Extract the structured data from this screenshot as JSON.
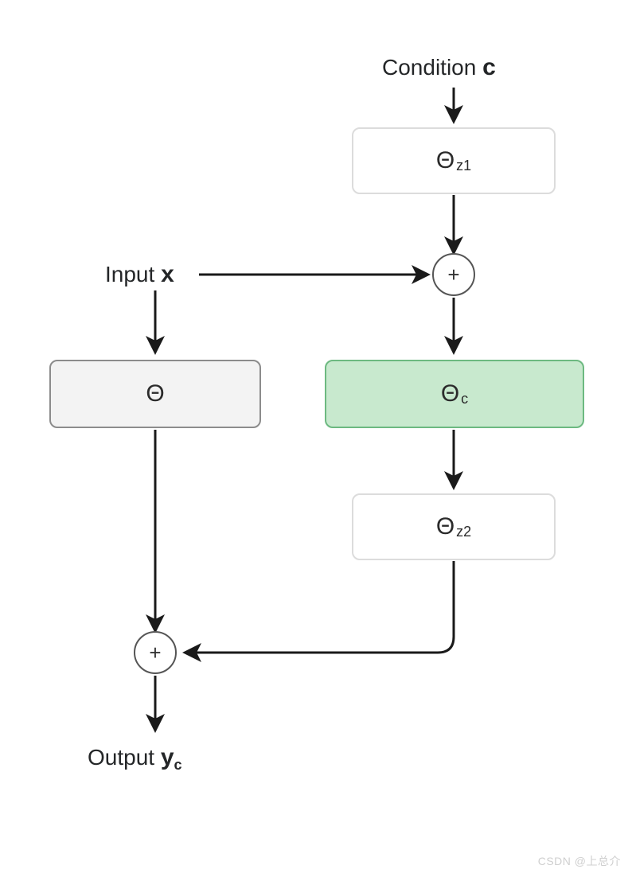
{
  "labels": {
    "condition_prefix": "Condition ",
    "condition_bold": "c",
    "input_prefix": "Input ",
    "input_bold": "x",
    "output_prefix": "Output ",
    "output_bold": "y",
    "output_sub": "c",
    "theta_z1_main": "Θ",
    "theta_z1_sub": "z1",
    "theta_main": "Θ",
    "theta_c_main": "Θ",
    "theta_c_sub": "c",
    "theta_z2_main": "Θ",
    "theta_z2_sub": "z2",
    "plus": "+"
  },
  "colors": {
    "box_light_border": "#dcdcdc",
    "box_light_fill": "#ffffff",
    "box_gray_border": "#8c8c8c",
    "box_gray_fill": "#f3f3f3",
    "box_green_border": "#6db981",
    "box_green_fill": "#c8e9ce",
    "arrow": "#1a1a1a"
  },
  "watermark": "CSDN @上总介"
}
